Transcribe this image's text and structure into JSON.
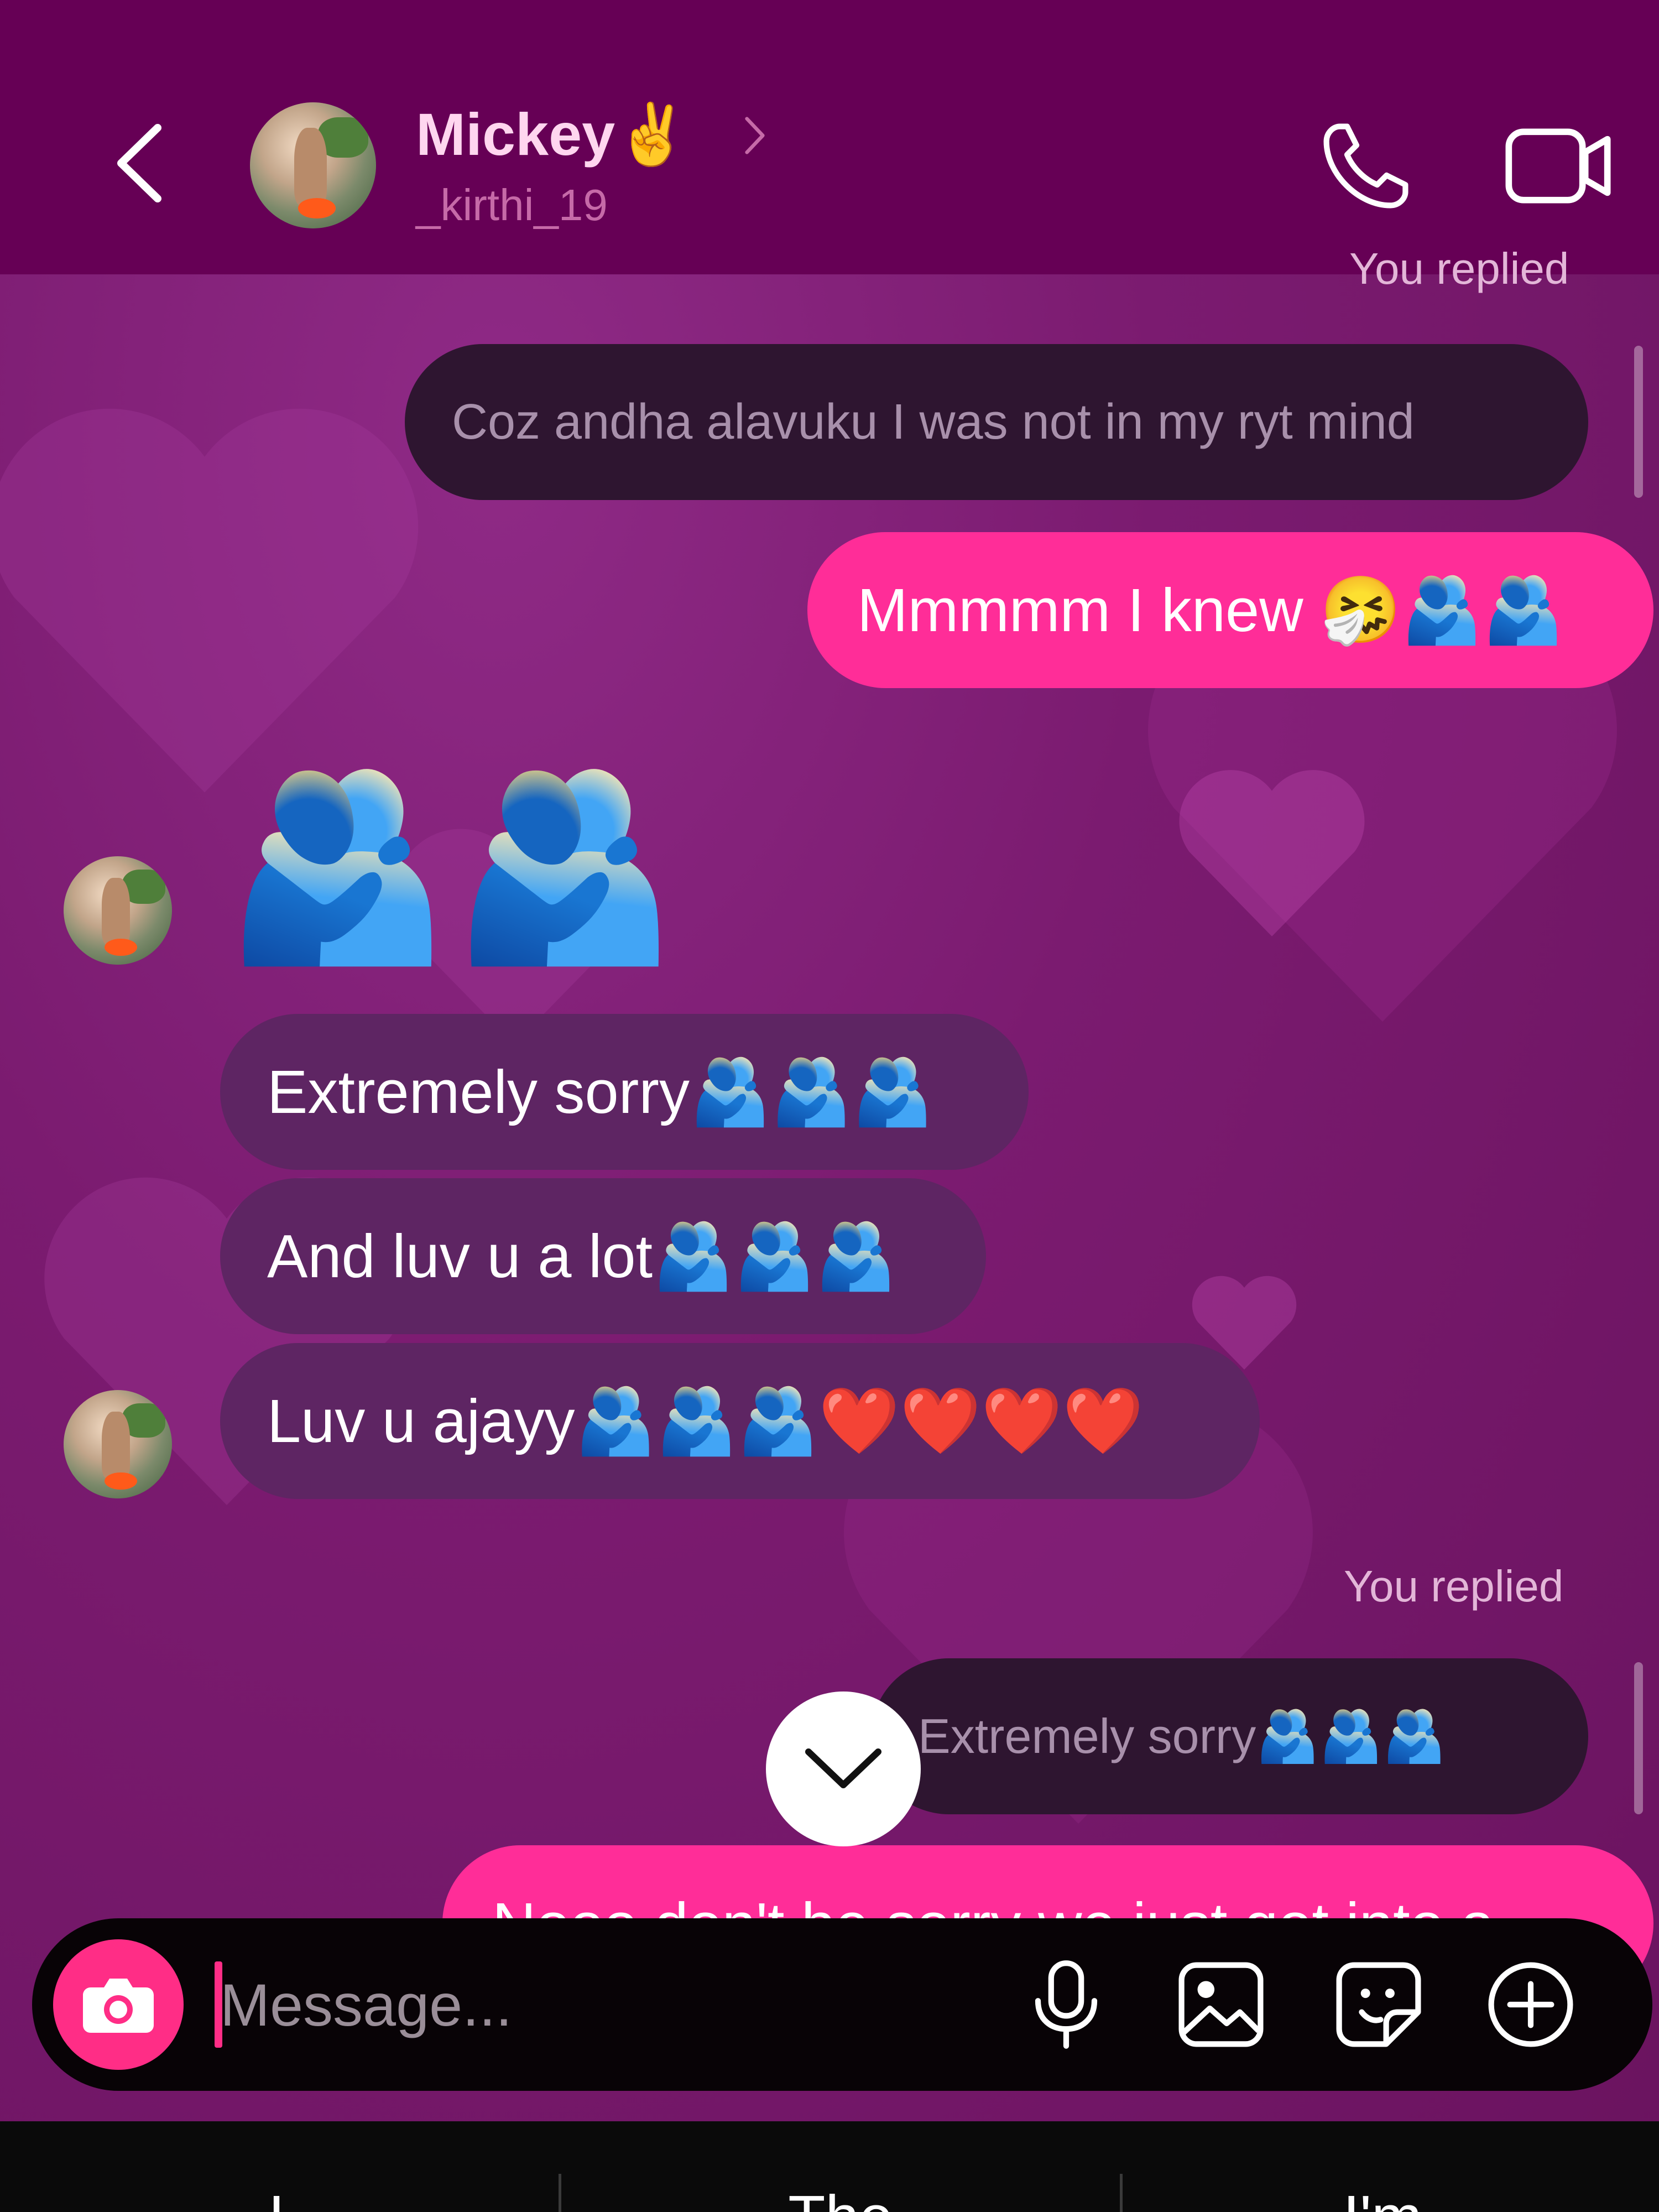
{
  "header": {
    "back_icon": "chevron-left-icon",
    "contact_name": "Mickey✌️",
    "contact_username": "_kirthi_19",
    "name_chevron_icon": "chevron-right-icon",
    "call_icon": "phone-icon",
    "video_icon": "video-camera-icon"
  },
  "messages": {
    "top_partial_label": "You replied",
    "reply_1": "Coz andha alavuku I was not in my ryt mind",
    "sent_1_text": "Mmmmm I knew ",
    "sent_1_emoji": "🤧🫂🫂",
    "received_big_emoji": "🫂🫂",
    "received_1_text": "Extremely sorry",
    "received_1_emoji": "🫂🫂🫂",
    "received_2_text": "And luv u a lot",
    "received_2_emoji": "🫂🫂🫂",
    "received_3_text": "Luv u ajayy",
    "received_3_emoji": "🫂🫂🫂❤️❤️❤️❤️",
    "replied_label": "You replied",
    "reply_2_text": "Extremely sorry",
    "reply_2_emoji": "🫂🫂🫂",
    "sent_2_partial": "Nooo don't be sorry we just got into a"
  },
  "scroll_down_icon": "chevron-down-icon",
  "composer": {
    "camera_icon": "camera-icon",
    "placeholder": "Message...",
    "mic_icon": "microphone-icon",
    "gallery_icon": "image-icon",
    "sticker_icon": "sticker-icon",
    "add_icon": "plus-circle-icon"
  },
  "keyboard_suggestions": [
    "I",
    "The",
    "I'm"
  ],
  "colors": {
    "header_bg": "#660055",
    "sent_bubble": "#ff2d98",
    "received_bubble": "#5e2563",
    "reply_bubble": "#2e1530",
    "accent": "#ff2d86"
  }
}
